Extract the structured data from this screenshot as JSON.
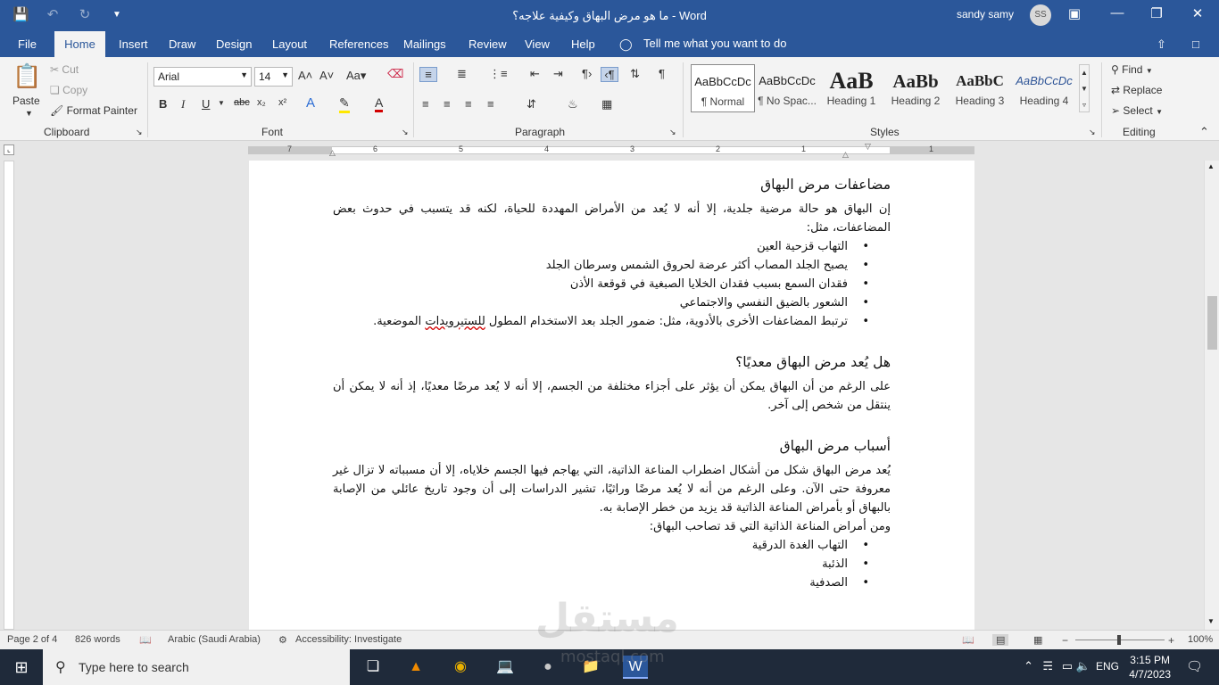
{
  "app": {
    "title": "ما هو مرض البهاق وكيفية علاجه؟  -  Word",
    "user": "sandy samy",
    "user_initials": "SS"
  },
  "qat": {
    "save_icon": "save-icon",
    "undo_icon": "undo-icon",
    "redo_icon": "redo-icon",
    "customize_icon": "chevron-down-icon"
  },
  "tabs": [
    {
      "label": "File"
    },
    {
      "label": "Home"
    },
    {
      "label": "Insert"
    },
    {
      "label": "Draw"
    },
    {
      "label": "Design"
    },
    {
      "label": "Layout"
    },
    {
      "label": "References"
    },
    {
      "label": "Mailings"
    },
    {
      "label": "Review"
    },
    {
      "label": "View"
    },
    {
      "label": "Help"
    }
  ],
  "tellme": "Tell me what you want to do",
  "clipboard": {
    "paste": "Paste",
    "cut": "Cut",
    "copy": "Copy",
    "format_painter": "Format Painter",
    "label": "Clipboard"
  },
  "font": {
    "name": "Arial",
    "size": "14",
    "label": "Font"
  },
  "paragraph": {
    "label": "Paragraph"
  },
  "styles": {
    "label": "Styles",
    "items": [
      {
        "sample": "AaBbCcDc",
        "name": "¶ Normal"
      },
      {
        "sample": "AaBbCcDc",
        "name": "¶ No Spac..."
      },
      {
        "sample": "AaB",
        "name": "Heading 1"
      },
      {
        "sample": "AaBb",
        "name": "Heading 2"
      },
      {
        "sample": "AaBbC",
        "name": "Heading 3"
      },
      {
        "sample": "AaBbCcDc",
        "name": "Heading 4"
      }
    ]
  },
  "editing": {
    "find": "Find",
    "replace": "Replace",
    "select": "Select",
    "label": "Editing"
  },
  "ruler": {
    "numbers": [
      "7",
      "6",
      "5",
      "4",
      "3",
      "2",
      "1",
      "1"
    ]
  },
  "document": {
    "s1": {
      "heading": "مضاعفات مرض البهاق",
      "para": "إن البهاق هو حالة مرضية جلدية، إلا أنه لا يُعد من الأمراض المهددة للحياة، لكنه قد يتسبب في حدوث بعض المضاعفات، مثل:",
      "items": [
        "التهاب قزحية العين",
        "يصبح الجلد المصاب أكثر عرضة لحروق الشمس وسرطان الجلد",
        "فقدان السمع بسبب فقدان الخلايا الصبغية في قوقعة الأذن",
        "الشعور بالضيق النفسي والاجتماعي"
      ],
      "item5_pre": "ترتبط المضاعفات الأخرى بالأدوية، مثل: ضمور الجلد بعد الاستخدام المطول ",
      "item5_err": "للستيرويدات",
      "item5_post": " الموضعية."
    },
    "s2": {
      "heading": "هل يُعد مرض البهاق معديًا؟",
      "para": "على الرغم من أن البهاق يمكن أن يؤثر على أجزاء مختلفة من الجسم، إلا أنه لا يُعد مرضًا معديًا، إذ أنه لا يمكن أن ينتقل من شخص إلى آخر."
    },
    "s3": {
      "heading": "أسباب مرض البهاق",
      "para": "يُعد مرض البهاق شكل من أشكال اضطراب المناعة الذاتية، التي يهاجم فيها الجسم خلاياه، إلا أن مسبباته لا تزال غير معروفة حتى الآن. وعلى الرغم من أنه لا يُعد مرضًا وراثيًا، تشير الدراسات إلى أن وجود تاريخ عائلي من الإصابة بالبهاق أو بأمراض المناعة الذاتية قد يزيد من خطر الإصابة به.",
      "para2": "ومن أمراض المناعة الذاتية التي قد تصاحب البهاق:",
      "items": [
        "التهاب الغدة الدرقية",
        "الذئبة",
        "الصدفية"
      ]
    }
  },
  "status": {
    "page": "Page 2 of 4",
    "words": "826 words",
    "language": "Arabic (Saudi Arabia)",
    "accessibility": "Accessibility: Investigate",
    "zoom": "100%",
    "zoom_minus": "−",
    "zoom_plus": "+"
  },
  "taskbar": {
    "search_placeholder": "Type here to search",
    "lang": "ENG",
    "time": "3:15 PM",
    "date": "4/7/2023"
  },
  "watermark": {
    "text": "مستقل",
    "site": "mostaql.com"
  }
}
